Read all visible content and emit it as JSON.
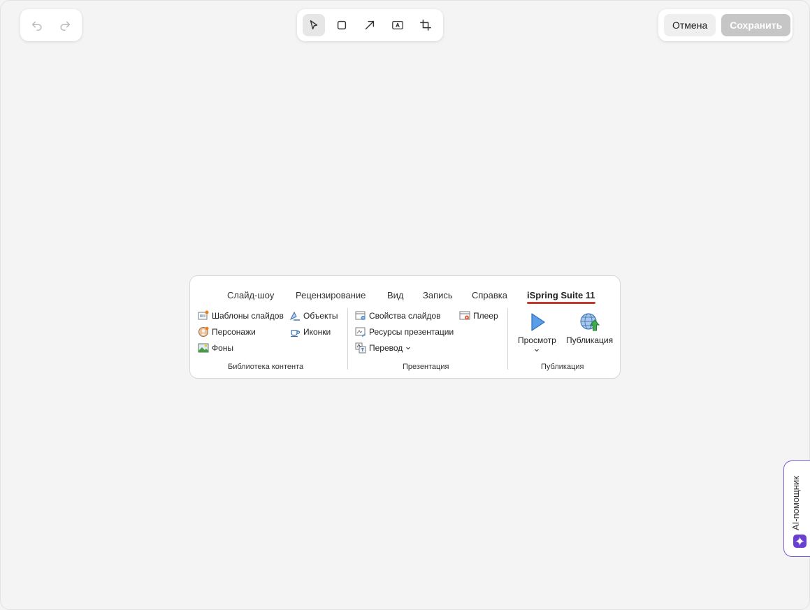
{
  "window": {
    "frame": "editor"
  },
  "history": {
    "undo_icon": "undo-icon",
    "redo_icon": "redo-icon"
  },
  "tools": [
    {
      "name": "select-tool",
      "icon": "cursor-icon",
      "active": true
    },
    {
      "name": "rectangle-tool",
      "icon": "square-icon",
      "active": false
    },
    {
      "name": "arrow-tool",
      "icon": "arrow-icon",
      "active": false
    },
    {
      "name": "text-tool",
      "icon": "text-box-icon",
      "active": false
    },
    {
      "name": "crop-tool",
      "icon": "crop-icon",
      "active": false
    }
  ],
  "actions": {
    "cancel_label": "Отмена",
    "save_label": "Сохранить"
  },
  "ribbon": {
    "tabs": [
      "Слайд-шоу",
      "Рецензирование",
      "Вид",
      "Запись",
      "Справка",
      "iSpring Suite 11"
    ],
    "active_tab": "iSpring Suite 11",
    "content_library": {
      "items": [
        "Шаблоны слайдов",
        "Объекты",
        "Персонажи",
        "Иконки",
        "Фоны"
      ],
      "label": "Библиотека контента"
    },
    "presentation": {
      "items": [
        "Свойства слайдов",
        "Плеер",
        "Ресурсы презентации",
        "Перевод"
      ],
      "label": "Презентация"
    },
    "publishing": {
      "preview_label": "Просмотр",
      "publish_label": "Публикация",
      "label": "Публикация"
    }
  },
  "ai_assistant": {
    "label": "AI-помощник"
  },
  "colors": {
    "accent": "#7c5cd9",
    "tab_underline": "#c0392b"
  }
}
